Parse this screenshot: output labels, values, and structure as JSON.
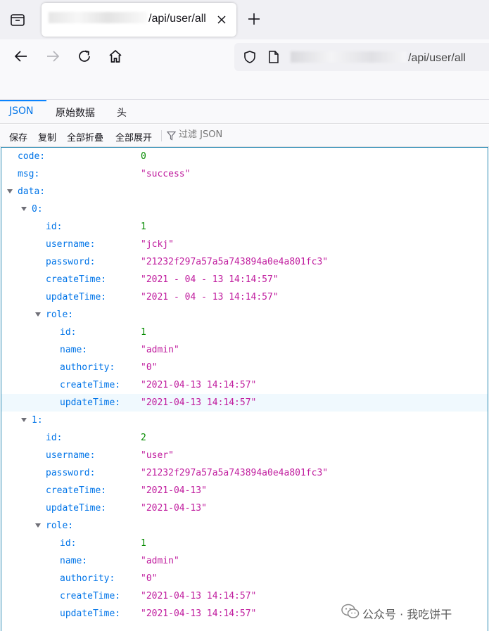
{
  "browser": {
    "tab": {
      "title_visible": "/api/user/all"
    },
    "urlbar": {
      "url_visible": "/api/user/all"
    },
    "icons": [
      "tab-overview-icon",
      "close-icon",
      "plus-icon",
      "back-arrow-icon",
      "forward-arrow-icon",
      "reload-icon",
      "home-icon",
      "shield-icon",
      "page-icon"
    ]
  },
  "viewer": {
    "tabs": [
      "JSON",
      "原始数据",
      "头"
    ],
    "active_tab": "JSON",
    "toolbar": {
      "save": "保存",
      "copy": "复制",
      "collapse_all": "全部折叠",
      "expand_all": "全部展开",
      "filter_placeholder": "过滤 JSON"
    }
  },
  "json_tree": {
    "code_key": "code:",
    "code_val": "0",
    "msg_key": "msg:",
    "msg_val": "\"success\"",
    "data_key": "data:",
    "items": [
      {
        "index": "0:",
        "id_key": "id:",
        "id_val": "1",
        "username_key": "username:",
        "username_val": "\"jckj\"",
        "password_key": "password:",
        "password_val": "\"21232f297a57a5a743894a0e4a801fc3\"",
        "createTime_key": "createTime:",
        "createTime_val": "\"2021 - 04 - 13 14:14:57\"",
        "updateTime_key": "updateTime:",
        "updateTime_val": "\"2021 - 04 - 13 14:14:57\"",
        "role_key": "role:",
        "role": {
          "id_key": "id:",
          "id_val": "1",
          "name_key": "name:",
          "name_val": "\"admin\"",
          "authority_key": "authority:",
          "authority_val": "\"0\"",
          "createTime_key": "createTime:",
          "createTime_val": "\"2021-04-13 14:14:57\"",
          "updateTime_key": "updateTime:",
          "updateTime_val": "\"2021-04-13 14:14:57\""
        }
      },
      {
        "index": "1:",
        "id_key": "id:",
        "id_val": "2",
        "username_key": "username:",
        "username_val": "\"user\"",
        "password_key": "password:",
        "password_val": "\"21232f297a57a5a743894a0e4a801fc3\"",
        "createTime_key": "createTime:",
        "createTime_val": "\"2021-04-13\"",
        "updateTime_key": "updateTime:",
        "updateTime_val": "\"2021-04-13\"",
        "role_key": "role:",
        "role": {
          "id_key": "id:",
          "id_val": "1",
          "name_key": "name:",
          "name_val": "\"admin\"",
          "authority_key": "authority:",
          "authority_val": "\"0\"",
          "createTime_key": "createTime:",
          "createTime_val": "\"2021-04-13 14:14:57\"",
          "updateTime_key": "updateTime:",
          "updateTime_val": "\"2021-04-13 14:14:57\""
        }
      }
    ]
  },
  "watermark": {
    "text": "公众号 · 我吃饼干"
  },
  "colors": {
    "key": "#0074e8",
    "number": "#058b00",
    "string": "#c01c9e",
    "accent": "#0a84ff",
    "tree_border": "#2b8ab3"
  }
}
